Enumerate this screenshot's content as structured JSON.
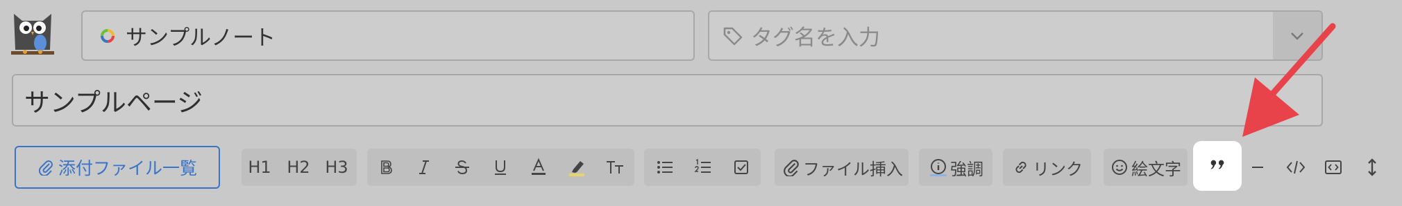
{
  "header": {
    "note_name": "サンプルノート",
    "tag_placeholder": "タグ名を入力"
  },
  "page": {
    "title": "サンプルページ"
  },
  "toolbar": {
    "attachments_label": "添付ファイル一覧",
    "headings": [
      "H1",
      "H2",
      "H3"
    ],
    "insert_file_label": "ファイル挿入",
    "emphasis_label": "強調",
    "link_label": "リンク",
    "emoji_label": "絵文字"
  },
  "colors": {
    "accent_blue": "#3b74c6",
    "arrow_red": "#e8434a",
    "background": "#c9c9c9"
  }
}
